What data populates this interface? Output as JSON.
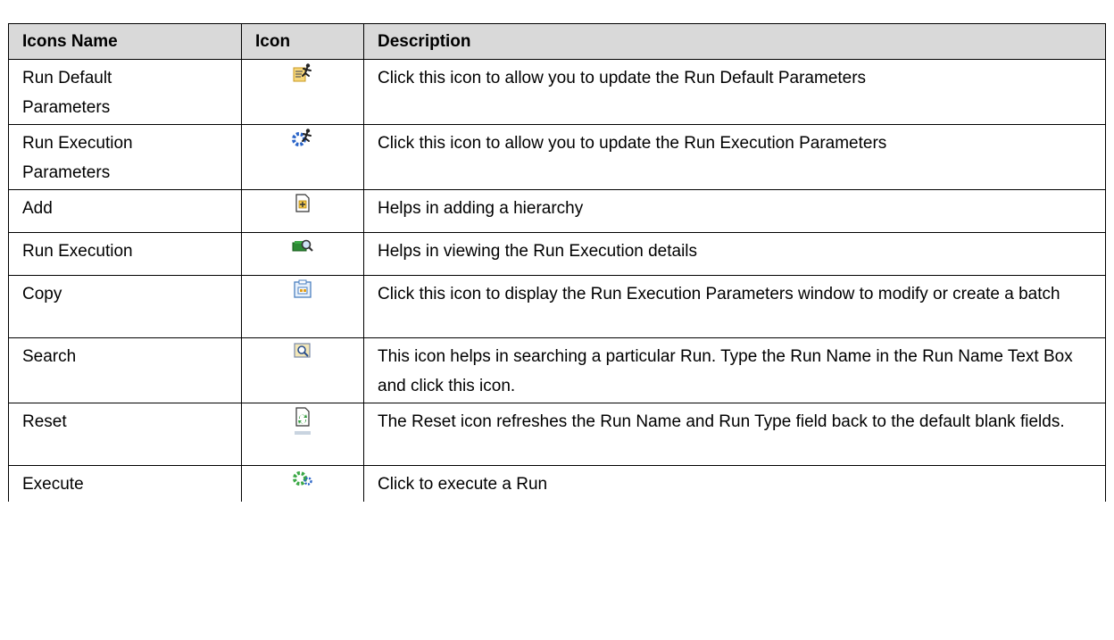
{
  "table": {
    "headers": {
      "name": "Icons Name",
      "icon": "Icon",
      "description": "Description"
    },
    "rows": [
      {
        "name": "Run Default Parameters",
        "icon": "run-default-parameters-icon",
        "description": "Click this icon to allow you to update the Run Default Parameters"
      },
      {
        "name": "Run Execution Parameters",
        "icon": "run-execution-parameters-icon",
        "description": "Click this icon to allow you to update the Run Execution Parameters"
      },
      {
        "name": "Add",
        "icon": "add-icon",
        "description": "Helps in adding a hierarchy"
      },
      {
        "name": "Run Execution",
        "icon": "run-execution-icon",
        "description": "Helps in viewing the Run Execution details"
      },
      {
        "name": "Copy",
        "icon": "copy-icon",
        "description": "Click this icon to display the Run Execution Parameters window to modify or create a batch"
      },
      {
        "name": "Search",
        "icon": "search-icon",
        "description": "This icon helps in searching a particular Run. Type the Run Name in the Run Name Text Box and click this icon."
      },
      {
        "name": "Reset",
        "icon": "reset-icon",
        "description": "The Reset icon refreshes the Run Name and Run Type field back to the default blank fields."
      },
      {
        "name": "Execute",
        "icon": "execute-icon",
        "description": "Click to execute a Run"
      }
    ]
  },
  "colors": {
    "header_bg": "#d9d9d9",
    "border": "#000000"
  }
}
